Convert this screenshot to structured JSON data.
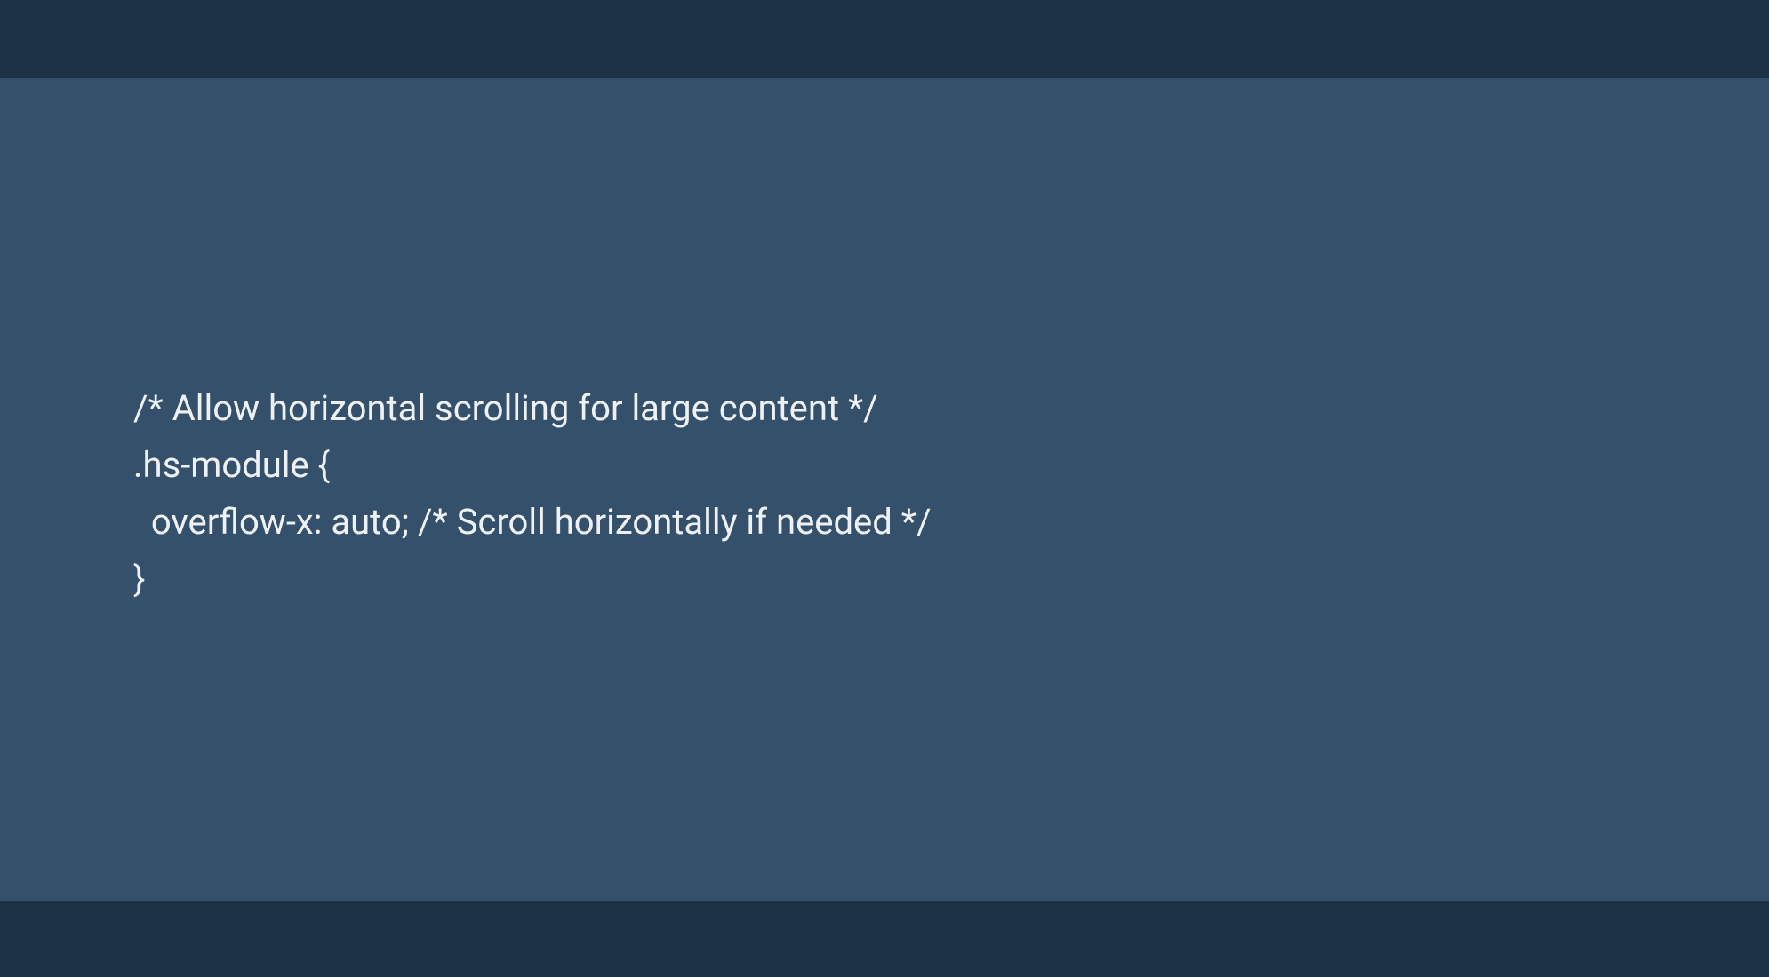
{
  "code": {
    "line1": "/* Allow horizontal scrolling for large content */",
    "line2": ".hs-module {",
    "line3": "  overflow-x: auto; /* Scroll horizontally if needed */",
    "line4": "}"
  },
  "colors": {
    "dark_band": "#1e3246",
    "main_bg": "#35506a",
    "text": "#eef1f4"
  }
}
